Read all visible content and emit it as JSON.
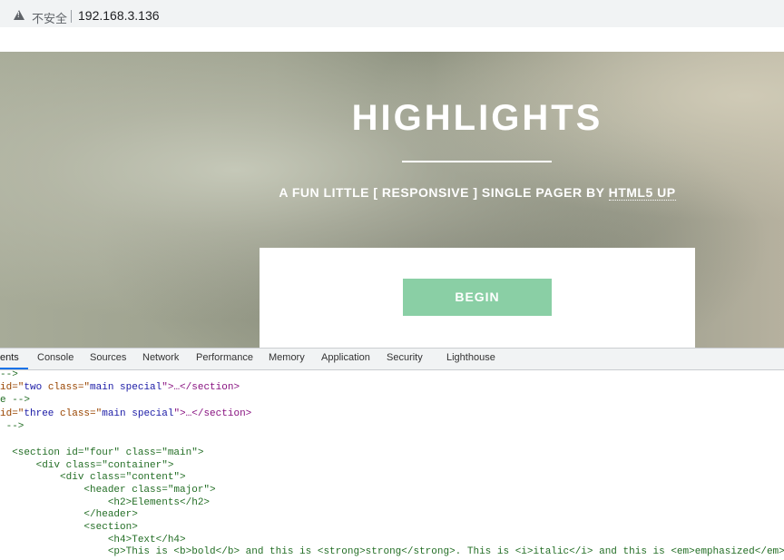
{
  "address_bar": {
    "security_label": "不安全",
    "url": "192.168.3.136"
  },
  "hero": {
    "title": "HIGHLIGHTS",
    "subtitle_prefix": "A FUN LITTLE [ RESPONSIVE ] SINGLE PAGER BY ",
    "subtitle_link": "HTML5 UP",
    "begin_label": "BEGIN"
  },
  "devtools": {
    "tabs": [
      "ents",
      "Console",
      "Sources",
      "Network",
      "Performance",
      "Memory",
      "Application",
      "Security",
      "Lighthouse"
    ],
    "code": {
      "l0": "-->",
      "l1_id_prefix": "id=\"",
      "l1_id": "two",
      "l1_class_attr": " class=\"",
      "l1_class": "main special",
      "l1_tail": "\">…</section>",
      "l2": "e -->",
      "l3_id_prefix": "id=\"",
      "l3_id": "three",
      "l3_class_attr": " class=\"",
      "l3_class": "main special",
      "l3_tail": "\">…</section>",
      "l4": " -->",
      "l5": "  <section id=\"four\" class=\"main\">",
      "l6": "      <div class=\"container\">",
      "l7": "          <div class=\"content\">",
      "l8": "              <header class=\"major\">",
      "l9": "                  <h2>Elements</h2>",
      "l10": "              </header>",
      "l11": "              <section>",
      "l12": "                  <h4>Text</h4>",
      "l13": "                  <p>This is <b>bold</b> and this is <strong>strong</strong>. This is <i>italic</i> and this is <em>emphasized</em>."
    }
  }
}
